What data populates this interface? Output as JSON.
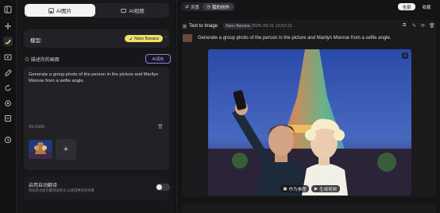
{
  "left_tabs": {
    "image": "AI图片",
    "video": "AI视频"
  },
  "model": {
    "label": "模型:",
    "value": "Nano Banana"
  },
  "prompt": {
    "section_label": "描述你的画面",
    "ai_button": "AI润色",
    "text": "Generate a group photo of the person in the picture and Marilyn Monroe from a selfie angle.",
    "counter": "91/1000"
  },
  "translate": {
    "label": "启用自动翻译",
    "hint": "将非英文提示翻译成英文,以获得更好的效果"
  },
  "top": {
    "inspiration": "灵感",
    "my_works": "我的创作",
    "all": "全部",
    "favorites": "收藏"
  },
  "result": {
    "title": "Text to Image",
    "model_badge": "Nano Banana",
    "timestamp": "2025-09-21 15:52:21",
    "prompt": "Generate a group photo of the person in the picture and Marilyn Monroe from a selfie angle.",
    "btn_reference": "作为参图",
    "btn_video": "生成视频"
  },
  "colors": {
    "accent_yellow": "#f1e06a",
    "accent_purple": "#8b7cf6"
  }
}
